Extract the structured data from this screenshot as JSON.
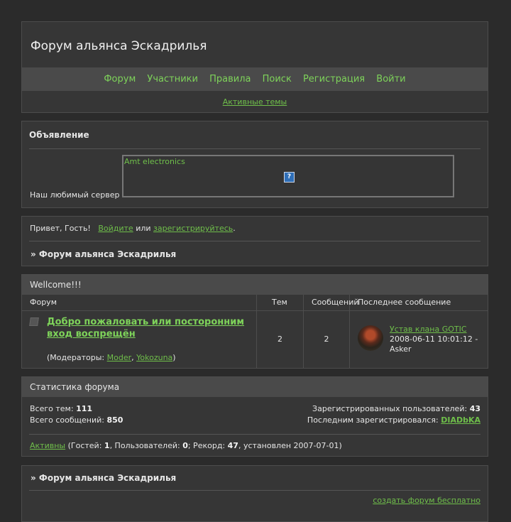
{
  "header": {
    "title": "Форум альянса Эскадрилья",
    "nav": [
      "Форум",
      "Участники",
      "Правила",
      "Поиск",
      "Регистрация",
      "Войти"
    ],
    "active_topics": "Активные темы"
  },
  "announcement": {
    "heading": "Объявление",
    "server_label": "Наш любимый сервер",
    "frame_label": "Amt electronics",
    "frame_icon": "?"
  },
  "greeting": {
    "hello": "Привет, Гость!",
    "login_link": "Войдите",
    "or": "или",
    "register_link": "зарегистрируйтесь",
    "period": ".",
    "breadcrumb": "» Форум альянса Эскадрилья"
  },
  "forums": {
    "caption": "Wellcome!!!",
    "columns": [
      "Форум",
      "Тем",
      "Сообщений",
      "Последнее сообщение"
    ],
    "row": {
      "name": "Добро пожаловать или посторонним вход воспрещён",
      "moderators_label": "(Модераторы: ",
      "moderators": [
        "Moder",
        "Yokozuna"
      ],
      "moderators_sep": ", ",
      "moderators_close": ")",
      "topics": "2",
      "posts": "2",
      "last_title": "Устав клана GOTIC",
      "last_date": "2008-06-11 10:01:12 -",
      "last_author": "Asker"
    }
  },
  "stats": {
    "caption": "Статистика форума",
    "total_topics_label": "Всего тем:",
    "total_topics": "111",
    "total_posts_label": "Всего сообщений:",
    "total_posts": "850",
    "registered_label": "Зарегистрированных пользователей:",
    "registered": "43",
    "last_reg_label": "Последним зарегистрировался:",
    "last_reg": "DIADbKA",
    "active_link": "Активны",
    "guests_label": "(Гостей:",
    "guests": "1",
    "users_label": ", Пользователей:",
    "users": "0",
    "record_label": "; Рекорд:",
    "record": "47",
    "record_date": ", установлен 2007-07-01)"
  },
  "footer": {
    "breadcrumb": "» Форум альянса Эскадрилья",
    "free_forum": "создать форум бесплатно"
  }
}
